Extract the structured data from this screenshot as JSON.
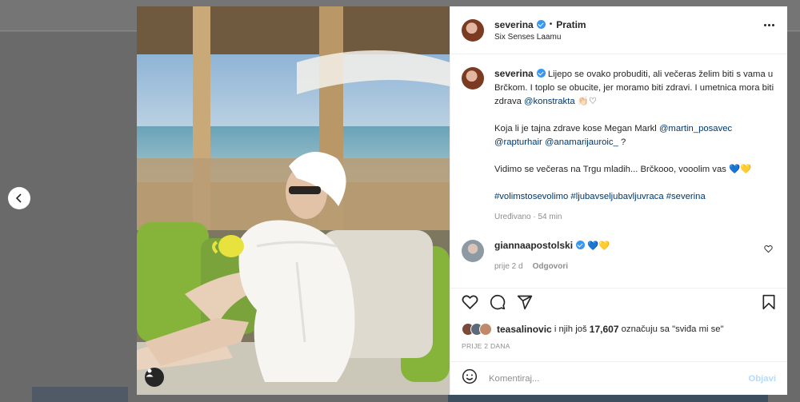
{
  "post": {
    "username": "severina",
    "follow_label": "Pratim",
    "separator": "•",
    "location": "Six Senses Laamu"
  },
  "caption": {
    "username": "severina",
    "p1_text": "Lijepo se ovako probuditi, ali večeras želim biti s vama u Brčkom. I toplo se obucite, jer moramo biti zdravi. I umetnica mora biti zdrava ",
    "p1_mention": "@konstrakta",
    "p1_emoji": " 👏🏻♡",
    "p2_text": "Koja li je tajna zdrave kose Megan Markl ",
    "p2_mention1": "@martin_posavec",
    "p2_mention2": "@rapturhair",
    "p2_mention3": "@anamarijauroic_",
    "p2_end": " ?",
    "p3_text": "Vidimo se večeras na Trgu mladih... Brčkooo, vooolim vas ",
    "p3_emoji": "💙💛",
    "hashtags": "#volimstosevolimo #ljubavseljubavljuvraca #severina",
    "edited": "Uređivano · 54 min"
  },
  "comment": {
    "username": "giannaapostolski",
    "emoji": "💙💛",
    "time": "prije 2 d",
    "reply_label": "Odgovori"
  },
  "likes": {
    "user": "teasalinovic",
    "text_mid": " i njih još ",
    "count": "17,607",
    "text_end": " označuju sa \"sviđa mi se\""
  },
  "timestamp": "PRIJE 2 DANA",
  "input": {
    "placeholder": "Komentiraj...",
    "post_label": "Objavi"
  },
  "icons": [
    "chevron-left-icon",
    "more-icon",
    "heart-icon",
    "comment-icon",
    "share-icon",
    "bookmark-icon",
    "emoji-icon",
    "user-tag-icon",
    "verified-icon"
  ],
  "colors": {
    "link": "#00376b",
    "verified": "#3897f0",
    "muted": "#8e8e8e",
    "post_disabled": "#b3dbff"
  }
}
